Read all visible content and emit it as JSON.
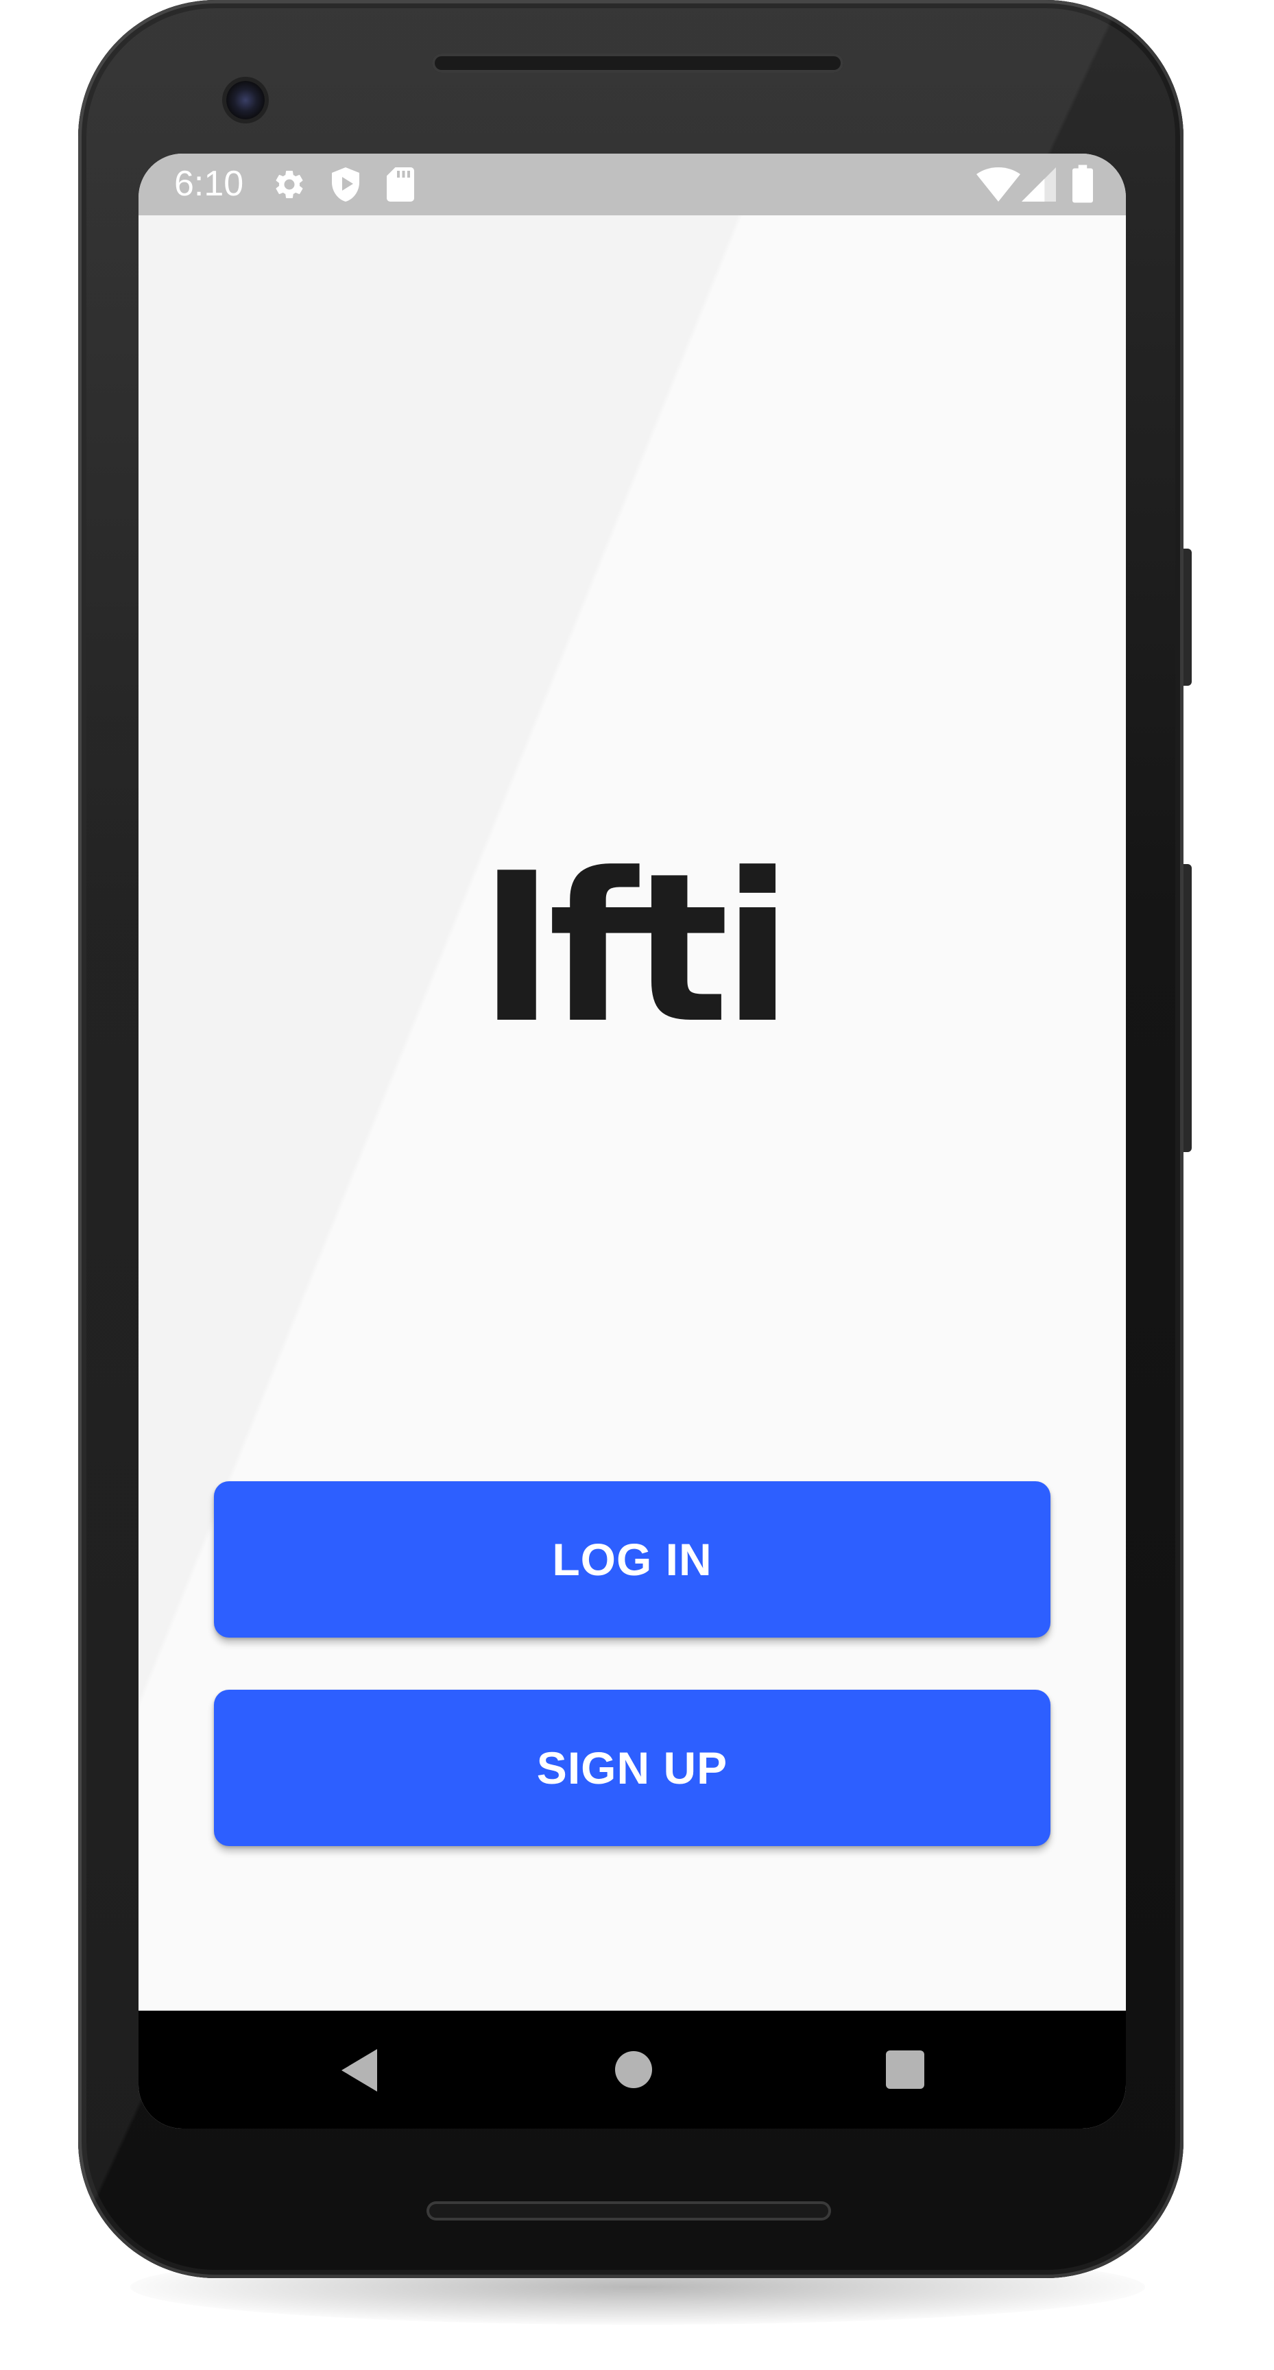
{
  "status_bar": {
    "time": "6:10",
    "left_icons": [
      "gear-icon",
      "shield-play-icon",
      "sd-card-icon"
    ],
    "right_icons": [
      "wifi-icon",
      "cell-signal-icon",
      "battery-icon"
    ],
    "background": "#c0c0c0"
  },
  "app": {
    "logo_text": "Ifti",
    "background": "#fafafa"
  },
  "buttons": {
    "login_label": "LOG IN",
    "signup_label": "SIGN UP",
    "color": "#2d5fff"
  },
  "nav_bar": {
    "icons": [
      "back-icon",
      "home-icon",
      "recents-icon"
    ]
  }
}
